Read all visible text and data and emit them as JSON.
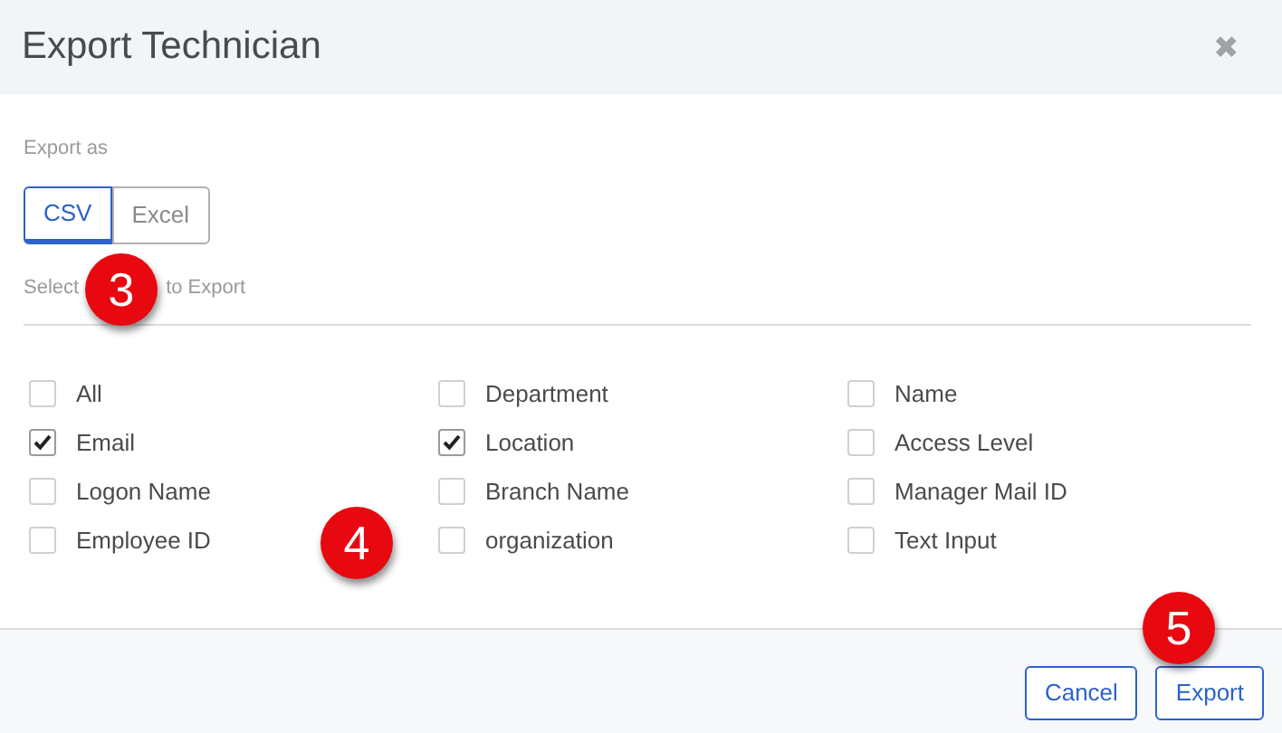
{
  "dialog": {
    "title": "Export Technician",
    "close": "✖"
  },
  "export_as": {
    "label": "Export as",
    "options": [
      {
        "label": "CSV",
        "selected": true
      },
      {
        "label": "Excel",
        "selected": false
      }
    ]
  },
  "fields_heading": [
    "Select",
    "to Export"
  ],
  "fields": [
    {
      "label": "All",
      "checked": false
    },
    {
      "label": "Department",
      "checked": false
    },
    {
      "label": "Name",
      "checked": false
    },
    {
      "label": "Email",
      "checked": true
    },
    {
      "label": "Location",
      "checked": true
    },
    {
      "label": "Access Level",
      "checked": false
    },
    {
      "label": "Logon Name",
      "checked": false
    },
    {
      "label": "Branch Name",
      "checked": false
    },
    {
      "label": "Manager Mail ID",
      "checked": false
    },
    {
      "label": "Employee ID",
      "checked": false
    },
    {
      "label": "organization",
      "checked": false
    },
    {
      "label": "Text Input",
      "checked": false
    }
  ],
  "buttons": [
    {
      "label": "Cancel"
    },
    {
      "label": "Export"
    }
  ],
  "callouts": [
    {
      "label": "3"
    },
    {
      "label": "4"
    },
    {
      "label": "5"
    }
  ]
}
